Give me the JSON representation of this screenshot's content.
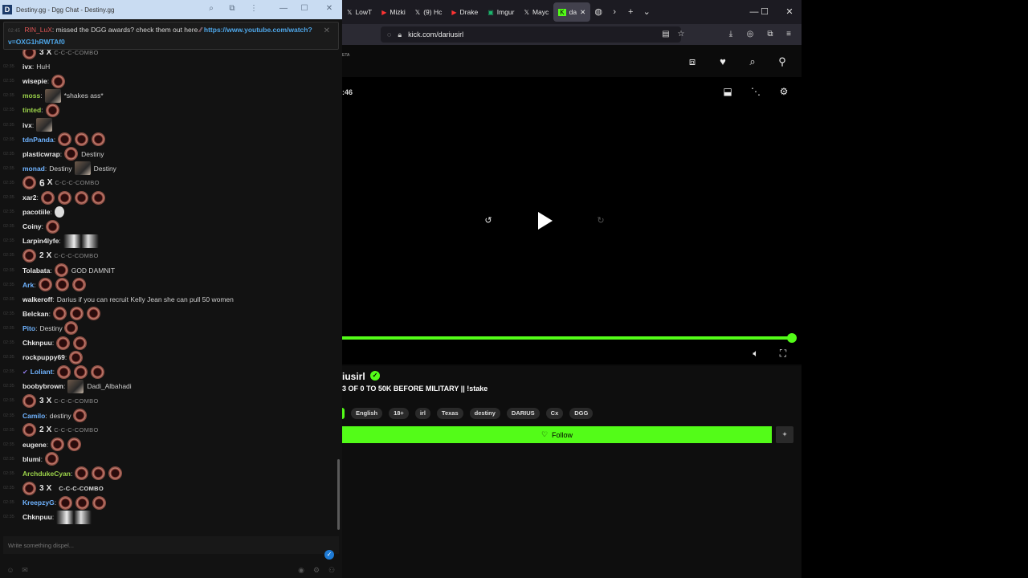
{
  "chat": {
    "title": "Destiny.gg - Dgg Chat - Destiny.gg",
    "announcement": {
      "ts": "02:45",
      "user": "RIN_LuX",
      "text": "missed the DGG awards? check them out here",
      "link": "https://www.youtube.com/watch?v=OXG1hRWTAf0"
    },
    "messages": [
      {
        "ts": "",
        "combo": "3",
        "combo_word": "C-C-C-COMBO"
      },
      {
        "ts": "02:35",
        "user": "ivx",
        "text": "HuH",
        "color": "#e8e8e8"
      },
      {
        "ts": "02:35",
        "user": "wisepie",
        "emotes": 1,
        "color": "#e8e8e8"
      },
      {
        "ts": "02:35",
        "user": "moss",
        "text": "*shakes ass*",
        "pic": true,
        "color": "#9cd34a"
      },
      {
        "ts": "02:35",
        "user": "tinted",
        "emotes": 1,
        "color": "#9cd34a"
      },
      {
        "ts": "02:35",
        "user": "ivx",
        "pic": true,
        "color": "#e8e8e8"
      },
      {
        "ts": "02:35",
        "user": "tdnPanda",
        "emotes": 3,
        "color": "#6fb3ff"
      },
      {
        "ts": "02:35",
        "user": "plasticwrap",
        "text": "Destiny",
        "emotes": 1,
        "color": "#e8e8e8"
      },
      {
        "ts": "02:35",
        "user": "monad",
        "text": "Destiny",
        "pre_text": "Destiny",
        "pic": true,
        "color": "#6fb3ff"
      },
      {
        "ts": "02:35",
        "combo": "6",
        "combo_word": "C-C-C-COMBO",
        "big": true
      },
      {
        "ts": "02:35",
        "user": "xar2",
        "emotes": 4,
        "color": "#e8e8e8"
      },
      {
        "ts": "02:35",
        "user": "pacotiile",
        "skull": true,
        "color": "#e8e8e8"
      },
      {
        "ts": "02:35",
        "user": "Coiny",
        "emotes": 1,
        "color": "#e8e8e8"
      },
      {
        "ts": "02:35",
        "user": "Larpin4lyfe",
        "pic2": true,
        "color": "#e8e8e8"
      },
      {
        "ts": "02:35",
        "combo": "2",
        "combo_word": "C-C-C-COMBO"
      },
      {
        "ts": "02:35",
        "user": "Tolabata",
        "text": "GOD DAMNIT",
        "emotes": 1,
        "color": "#e8e8e8"
      },
      {
        "ts": "02:35",
        "user": "Ark",
        "emotes": 3,
        "color": "#6fb3ff"
      },
      {
        "ts": "02:35",
        "user": "walkeroff",
        "text": "Darius if you can recruit Kelly Jean she can pull 50 women",
        "color": "#e8e8e8"
      },
      {
        "ts": "02:35",
        "user": "Belckan",
        "emotes": 3,
        "color": "#e8e8e8"
      },
      {
        "ts": "02:35",
        "user": "Pito",
        "text": "Destiny",
        "emotes_after": 1,
        "color": "#6fb3ff"
      },
      {
        "ts": "02:35",
        "user": "Chknpuu",
        "emotes": 2,
        "color": "#e8e8e8"
      },
      {
        "ts": "02:35",
        "user": "rockpuppy69",
        "emotes": 1,
        "color": "#e8e8e8"
      },
      {
        "ts": "02:35",
        "user": "Loliant",
        "emotes": 3,
        "badge": true,
        "color": "#6fb3ff"
      },
      {
        "ts": "02:35",
        "user": "boobybrown",
        "text": "Dadi_Albahadi",
        "pic": true,
        "color": "#e8e8e8"
      },
      {
        "ts": "02:35",
        "combo": "3",
        "combo_word": "C-C-C-COMBO"
      },
      {
        "ts": "02:35",
        "user": "Camilo",
        "text": "destiny",
        "emotes_after": 1,
        "color": "#6fb3ff"
      },
      {
        "ts": "02:35",
        "combo": "2",
        "combo_word": "C-C-C-COMBO"
      },
      {
        "ts": "02:35",
        "user": "eugene",
        "emotes": 2,
        "color": "#e8e8e8"
      },
      {
        "ts": "02:35",
        "user": "blumi",
        "emotes": 1,
        "color": "#e8e8e8"
      },
      {
        "ts": "02:35",
        "user": "ArchdukeCyan",
        "emotes": 3,
        "color": "#9cd34a"
      },
      {
        "ts": "02:35",
        "combo": "3",
        "combo_word": "C-C-C-COMBO",
        "bold_word": true
      },
      {
        "ts": "02:35",
        "user": "KreepzyG",
        "emotes": 3,
        "color": "#6fb3ff"
      },
      {
        "ts": "02:35",
        "user": "Chknpuu",
        "pic2": true,
        "color": "#e8e8e8"
      }
    ],
    "input_placeholder": "Write something dispel..."
  },
  "browser": {
    "tabs": [
      {
        "fav": "𝕏",
        "label": "LowT"
      },
      {
        "fav": "▶",
        "label": "Mizki"
      },
      {
        "fav": "𝕏",
        "label": "(9) Hc"
      },
      {
        "fav": "▶",
        "label": "Drake"
      },
      {
        "fav": "▣",
        "label": "Imgur"
      },
      {
        "fav": "𝕏",
        "label": "Mayc"
      },
      {
        "fav": "K",
        "label": "da"
      }
    ],
    "url": "kick.com/dariusirl"
  },
  "stream": {
    "time": ":46",
    "channel": "iusirl",
    "title": "3 OF 0 TO 50K BEFORE MILITARY || !stake",
    "tags": [
      "English",
      "18+",
      "irl",
      "Texas",
      "destiny",
      "DARIUS",
      "Cx",
      "DGG"
    ],
    "follow_label": "Follow",
    "progress_fraction": 1.0,
    "accent": "#53fc18"
  }
}
